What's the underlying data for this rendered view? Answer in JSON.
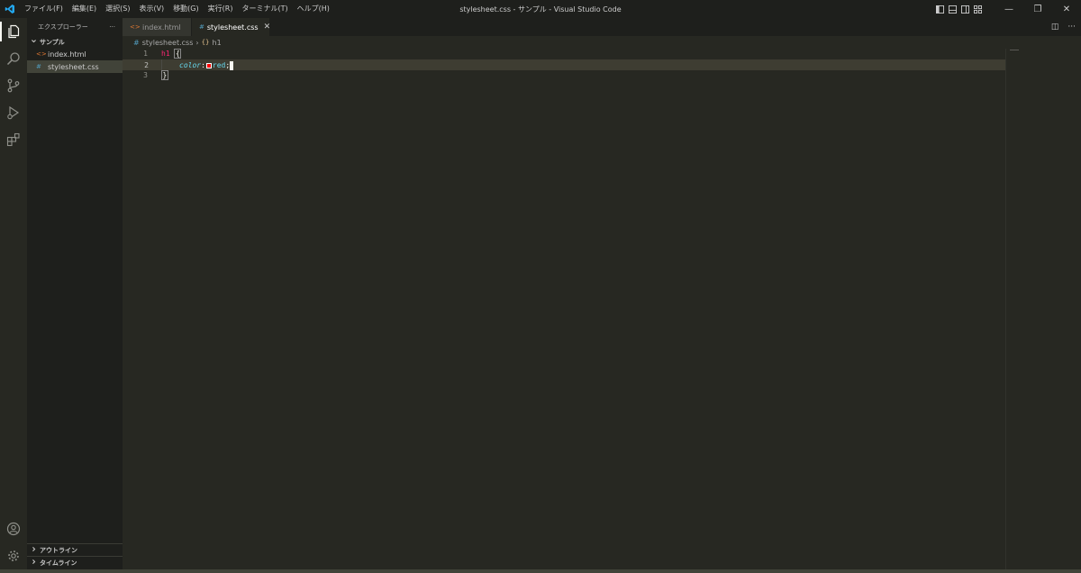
{
  "titlebar": {
    "menu": [
      "ファイル(F)",
      "編集(E)",
      "選択(S)",
      "表示(V)",
      "移動(G)",
      "実行(R)",
      "ターミナル(T)",
      "ヘルプ(H)"
    ],
    "window_title": "stylesheet.css - サンプル - Visual Studio Code",
    "minimize": "—",
    "restore": "❐",
    "close": "✕"
  },
  "sidebar": {
    "title": "エクスプローラー",
    "more": "···",
    "folder": "サンプル",
    "files": [
      {
        "name": "index.html",
        "icon": "<>"
      },
      {
        "name": "stylesheet.css",
        "icon": "#"
      }
    ],
    "outline": "アウトライン",
    "timeline": "タイムライン"
  },
  "tabs": [
    {
      "label": "index.html",
      "icon": "<>"
    },
    {
      "label": "stylesheet.css",
      "icon": "#",
      "close": "✕"
    }
  ],
  "tab_actions": {
    "split": "◫",
    "more": "···"
  },
  "breadcrumb": {
    "file_icon": "#",
    "file": "stylesheet.css",
    "sep": "›",
    "symbol_icon": "{}",
    "symbol": "h1"
  },
  "editor": {
    "line_numbers": [
      "1",
      "2",
      "3"
    ],
    "selector": "h1",
    "open_brace": "{",
    "property": "color",
    "colon": ":",
    "value": "red",
    "semicolon": ";",
    "close_brace": "}",
    "swatch_color": "#ff0000"
  },
  "colors": {
    "editor_bg": "#272822",
    "sidebar_bg": "#1e1f1c",
    "selector": "#f92672",
    "keyword": "#66d9ef",
    "vscode_blue": "#23a9f2"
  }
}
